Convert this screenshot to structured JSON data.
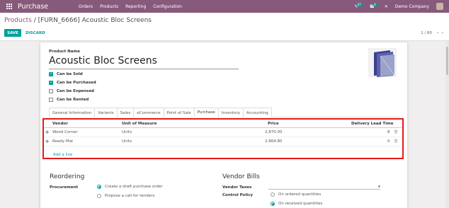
{
  "navbar": {
    "brand": "Purchase",
    "menu": [
      "Orders",
      "Products",
      "Reporting",
      "Configuration"
    ],
    "chat_count": "47",
    "activity_count": "4",
    "company": "Demo Company"
  },
  "control_panel": {
    "breadcrumb_parent": "Products",
    "breadcrumb_sep": " / ",
    "breadcrumb_current": "[FURN_6666] Acoustic Bloc Screens",
    "save_label": "SAVE",
    "discard_label": "DISCARD",
    "pager": "1 / 80"
  },
  "form": {
    "name_label": "Product Name",
    "name_value": "Acoustic Bloc Screens",
    "checkboxes": [
      {
        "label": "Can be Sold",
        "checked": true
      },
      {
        "label": "Can be Purchased",
        "checked": true
      },
      {
        "label": "Can be Expensed",
        "checked": false
      },
      {
        "label": "Can be Rented",
        "checked": false
      }
    ],
    "tabs": [
      "General Information",
      "Variants",
      "Sales",
      "eCommerce",
      "Point of Sale",
      "Purchase",
      "Inventory",
      "Accounting"
    ],
    "active_tab": "Purchase"
  },
  "vendors": {
    "headers": {
      "vendor": "Vendor",
      "uom": "Unit of Measure",
      "price": "Price",
      "lead": "Delivery Lead Time"
    },
    "rows": [
      {
        "vendor": "Wood Corner",
        "uom": "Units",
        "price": "2,870.00",
        "lead": "8"
      },
      {
        "vendor": "Ready Mat",
        "uom": "Units",
        "price": "2,864.80",
        "lead": "0"
      }
    ],
    "add_line": "Add a line"
  },
  "reordering": {
    "title": "Reordering",
    "procurement_label": "Procurement",
    "options": [
      {
        "label": "Create a draft purchase order",
        "selected": true
      },
      {
        "label": "Propose a call for tenders",
        "selected": false
      }
    ]
  },
  "vendor_bills": {
    "title": "Vendor Bills",
    "taxes_label": "Vendor Taxes",
    "taxes_value": "",
    "control_label": "Control Policy",
    "options": [
      {
        "label": "On ordered quantities",
        "selected": false
      },
      {
        "label": "On received quantities",
        "selected": true
      }
    ]
  },
  "colors": {
    "brand": "#875a7b",
    "accent": "#00a09d",
    "highlight": "#e01b1b"
  }
}
